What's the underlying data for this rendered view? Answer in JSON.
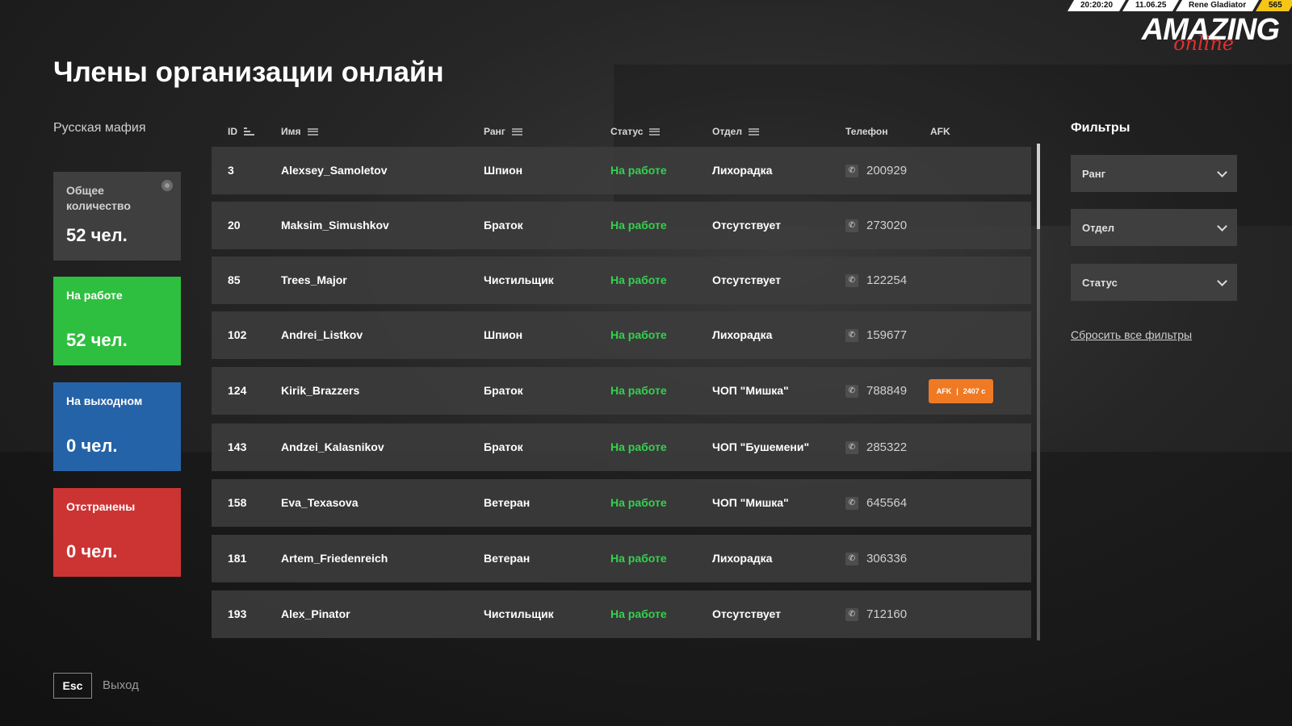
{
  "hud": {
    "time": "20:20:20",
    "date": "11.06.25",
    "player": "Rene Gladiator",
    "id": "565"
  },
  "logo": {
    "main": "AMAZING",
    "sub": "online"
  },
  "title": "Члены организации онлайн",
  "organization": "Русская мафия",
  "stats": {
    "total": {
      "label": "Общее количество",
      "value": "52 чел.",
      "color": "#3f3f3f"
    },
    "working": {
      "label": "На работе",
      "value": "52 чел.",
      "color": "#2fbf40"
    },
    "off": {
      "label": "На выходном",
      "value": "0 чел.",
      "color": "#2563a8"
    },
    "suspended": {
      "label": "Отстранены",
      "value": "0 чел.",
      "color": "#cc3434"
    }
  },
  "table": {
    "headers": {
      "id": "ID",
      "name": "Имя",
      "rank": "Ранг",
      "status": "Статус",
      "dept": "Отдел",
      "phone": "Телефон",
      "afk": "AFK"
    },
    "rows": [
      {
        "id": "3",
        "name": "Alexsey_Samoletov",
        "rank": "Шпион",
        "status": "На работе",
        "dept": "Лихорадка",
        "phone": "200929"
      },
      {
        "id": "20",
        "name": "Maksim_Simushkov",
        "rank": "Браток",
        "status": "На работе",
        "dept": "Отсутствует",
        "phone": "273020"
      },
      {
        "id": "85",
        "name": "Trees_Major",
        "rank": "Чистильщик",
        "status": "На работе",
        "dept": "Отсутствует",
        "phone": "122254"
      },
      {
        "id": "102",
        "name": "Andrei_Listkov",
        "rank": "Шпион",
        "status": "На работе",
        "dept": "Лихорадка",
        "phone": "159677"
      },
      {
        "id": "124",
        "name": "Kirik_Brazzers",
        "rank": "Браток",
        "status": "На работе",
        "dept": "ЧОП \"Мишка\"",
        "phone": "788849",
        "afk_label": "AFK",
        "afk_time": "2407 с"
      },
      {
        "id": "143",
        "name": "Andzei_Kalasnikov",
        "rank": "Браток",
        "status": "На работе",
        "dept": "ЧОП \"Бушемени\"",
        "phone": "285322"
      },
      {
        "id": "158",
        "name": "Eva_Texasova",
        "rank": "Ветеран",
        "status": "На работе",
        "dept": "ЧОП \"Мишка\"",
        "phone": "645564"
      },
      {
        "id": "181",
        "name": "Artem_Friedenreich",
        "rank": "Ветеран",
        "status": "На работе",
        "dept": "Лихорадка",
        "phone": "306336"
      },
      {
        "id": "193",
        "name": "Alex_Pinator",
        "rank": "Чистильщик",
        "status": "На работе",
        "dept": "Отсутствует",
        "phone": "712160"
      }
    ]
  },
  "filters": {
    "title": "Фильтры",
    "rank": "Ранг",
    "dept": "Отдел",
    "status": "Статус",
    "reset": "Сбросить все фильтры"
  },
  "footer": {
    "key": "Esc",
    "label": "Выход"
  },
  "colors": {
    "status_active": "#35d050",
    "afk_badge": "#f07a23",
    "accent_red": "#e03030"
  }
}
